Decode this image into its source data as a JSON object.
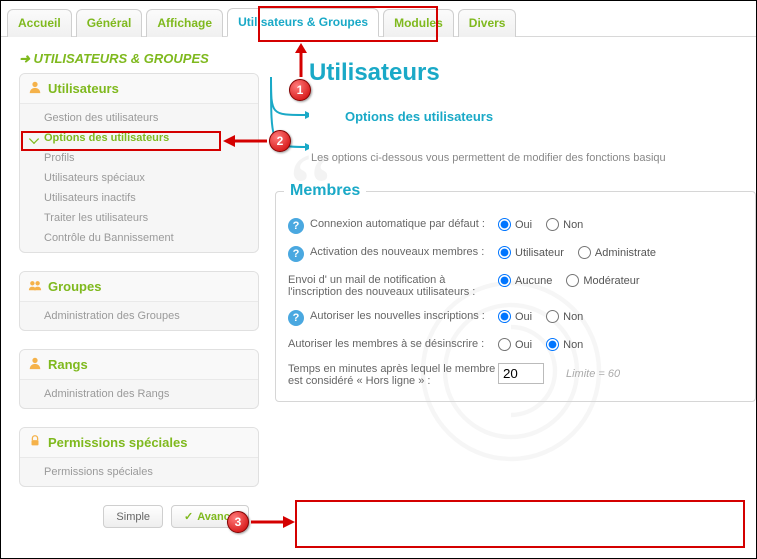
{
  "tabs": {
    "items": [
      {
        "label": "Accueil"
      },
      {
        "label": "Général"
      },
      {
        "label": "Affichage"
      },
      {
        "label": "Utilisateurs & Groupes",
        "active": true
      },
      {
        "label": "Modules"
      },
      {
        "label": "Divers"
      }
    ]
  },
  "sidebar": {
    "crumb": "UTILISATEURS & GROUPES",
    "panels": [
      {
        "title": "Utilisateurs",
        "icon": "user",
        "items": [
          {
            "label": "Gestion des utilisateurs"
          },
          {
            "label": "Options des utilisateurs",
            "selected": true
          },
          {
            "label": "Profils"
          },
          {
            "label": "Utilisateurs spéciaux"
          },
          {
            "label": "Utilisateurs inactifs"
          },
          {
            "label": "Traiter les utilisateurs"
          },
          {
            "label": "Contrôle du Bannissement"
          }
        ]
      },
      {
        "title": "Groupes",
        "icon": "group",
        "items": [
          {
            "label": "Administration des Groupes"
          }
        ]
      },
      {
        "title": "Rangs",
        "icon": "rank",
        "items": [
          {
            "label": "Administration des Rangs"
          }
        ]
      },
      {
        "title": "Permissions spéciales",
        "icon": "perm",
        "items": [
          {
            "label": "Permissions spéciales"
          }
        ]
      }
    ],
    "mode": {
      "simple": "Simple",
      "advanced": "Avancé"
    }
  },
  "page": {
    "title": "Utilisateurs",
    "subtitle": "Options des utilisateurs",
    "intro": "Les options ci-dessous vous permettent de modifier des fonctions basiqu"
  },
  "members": {
    "legend": "Membres",
    "rows": [
      {
        "help": true,
        "label": "Connexion automatique par défaut :",
        "options": [
          "Oui",
          "Non"
        ],
        "checked": 0
      },
      {
        "help": true,
        "label": "Activation des nouveaux membres :",
        "options": [
          "Utilisateur",
          "Administrate"
        ],
        "checked": 0
      },
      {
        "help": false,
        "label": "Envoi d' un mail de notification à l'inscription des nouveaux utilisateurs :",
        "options": [
          "Aucune",
          "Modérateur"
        ],
        "checked": 0
      },
      {
        "help": true,
        "label": "Autoriser les nouvelles inscriptions :",
        "options": [
          "Oui",
          "Non"
        ],
        "checked": 0
      },
      {
        "help": false,
        "label": "Autoriser les membres à se désinscrire :",
        "options": [
          "Oui",
          "Non"
        ],
        "checked": 1
      },
      {
        "help": false,
        "label": "Temps en minutes après lequel le membre est considéré « Hors ligne » :",
        "input": "20",
        "hint": "Limite = 60"
      }
    ]
  },
  "callouts": {
    "1": "1",
    "2": "2",
    "3": "3"
  }
}
